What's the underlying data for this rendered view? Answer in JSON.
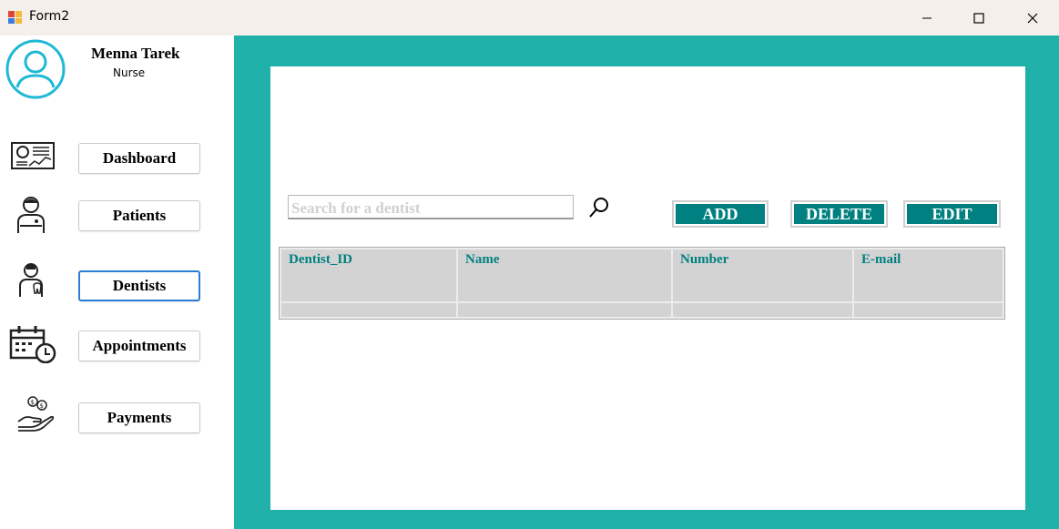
{
  "window": {
    "title": "Form2",
    "icons": [
      "app-icon",
      "minimize-icon",
      "maximize-icon",
      "close-icon"
    ]
  },
  "user": {
    "name": "Menna Tarek",
    "role": "Nurse",
    "icon": "user-avatar-icon"
  },
  "nav": {
    "items": [
      {
        "label": "Dashboard",
        "icon": "dashboard-icon"
      },
      {
        "label": "Patients",
        "icon": "patient-icon"
      },
      {
        "label": "Dentists",
        "icon": "dentist-icon",
        "active": true
      },
      {
        "label": "Appointments",
        "icon": "calendar-clock-icon"
      },
      {
        "label": "Payments",
        "icon": "payment-hand-icon"
      }
    ]
  },
  "search": {
    "placeholder": "Search for a dentist",
    "icon": "search-icon"
  },
  "actions": {
    "add": "ADD",
    "delete": "DELETE",
    "edit": "EDIT"
  },
  "table": {
    "columns": [
      "Dentist_ID",
      "Name",
      "Number",
      "E-mail"
    ],
    "rows": [
      [
        "",
        "",
        "",
        ""
      ]
    ]
  },
  "colors": {
    "accent": "#20b2aa",
    "button": "#008080",
    "header_text": "#008080",
    "cell": "#d3d3d3"
  }
}
